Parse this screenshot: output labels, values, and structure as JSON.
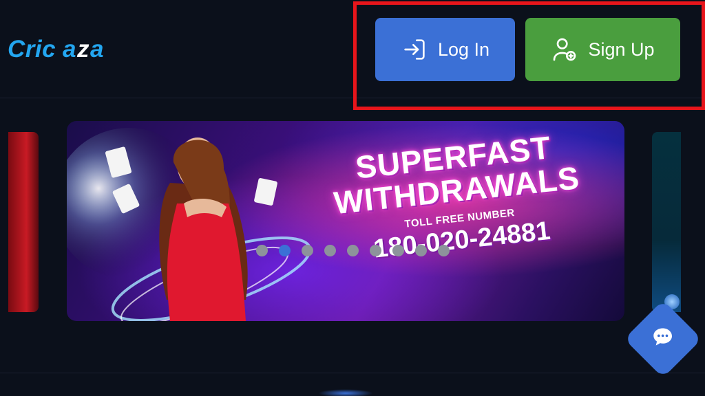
{
  "header": {
    "logo_text": "Cricaza",
    "login_label": "Log In",
    "signup_label": "Sign Up"
  },
  "banner": {
    "line1": "SUPERFAST",
    "line2": "WITHDRAWALS",
    "line3": "TOLL FREE NUMBER",
    "line4": "180-020-24881"
  },
  "carousel": {
    "dot_count": 9,
    "active_index": 1
  },
  "colors": {
    "background": "#0b101b",
    "login_button": "#3b70d6",
    "signup_button": "#4a9e3e",
    "logo": "#23a6f0",
    "highlight": "#e8151b"
  },
  "icons": [
    "login-icon",
    "user-add-icon",
    "chat-icon"
  ]
}
